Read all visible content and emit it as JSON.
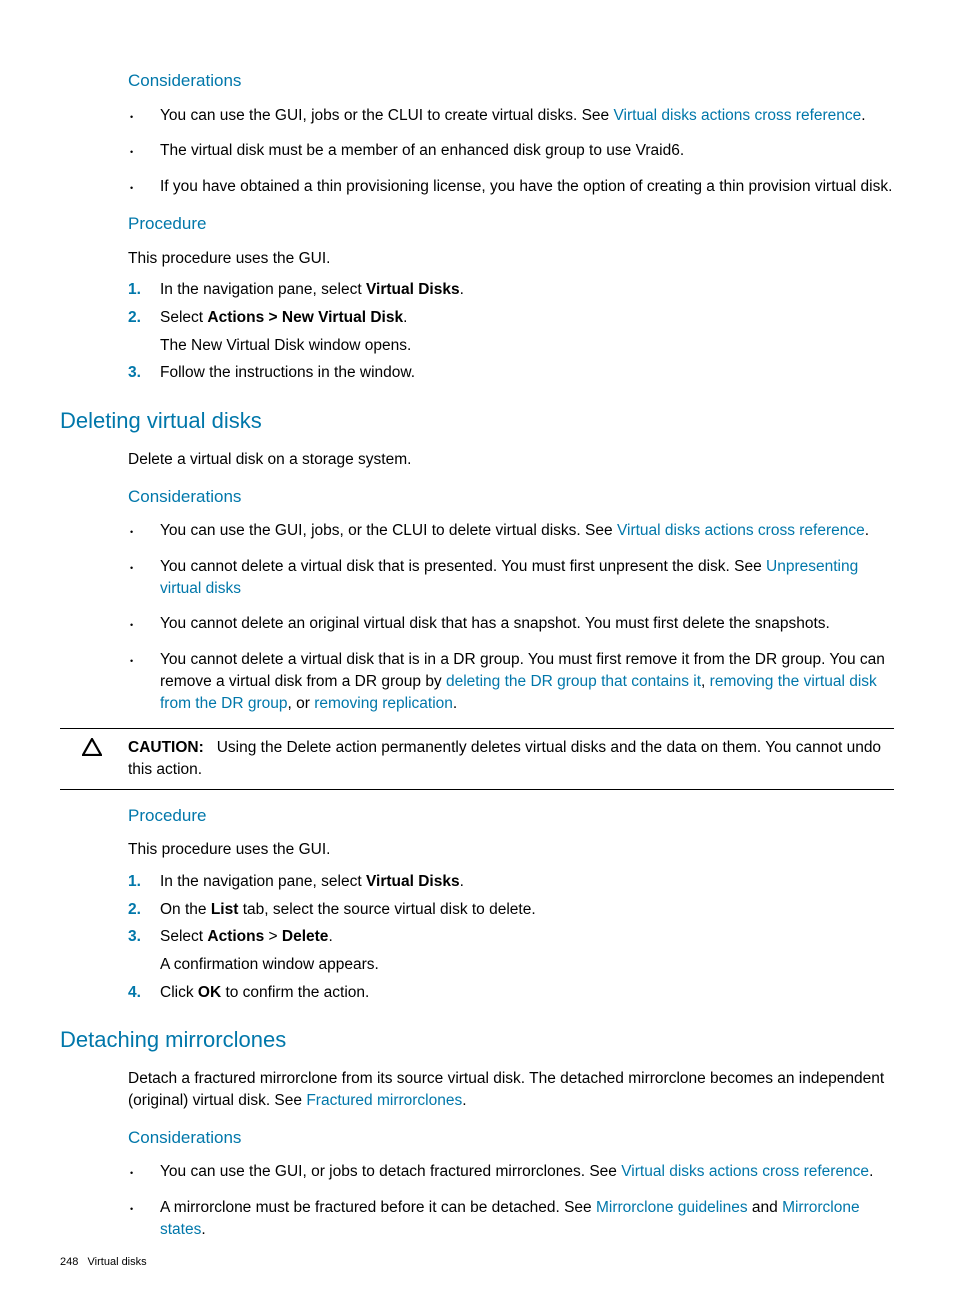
{
  "section1": {
    "considerations_h": "Considerations",
    "bullets": {
      "b1a": "You can use the GUI, jobs or the CLUI to create virtual disks. See ",
      "b1_link": "Virtual disks actions cross reference",
      "b2": "The virtual disk must be a member of an enhanced disk group to use Vraid6.",
      "b3": "If you have obtained a thin provisioning license, you have the option of creating a thin provision virtual disk."
    },
    "procedure_h": "Procedure",
    "procedure_intro": "This procedure uses the GUI.",
    "steps": {
      "s1a": "In the navigation pane, select ",
      "s1b": "Virtual Disks",
      "s1c": ".",
      "s2a": "Select ",
      "s2b": "Actions > New Virtual Disk",
      "s2c": ".",
      "s2_sub": "The New Virtual Disk window opens.",
      "s3": "Follow the instructions in the window."
    }
  },
  "section2": {
    "h": "Deleting virtual disks",
    "intro": "Delete a virtual disk on a storage system.",
    "considerations_h": "Considerations",
    "bullets": {
      "b1a": "You can use the GUI, jobs, or the CLUI to delete virtual disks. See ",
      "b1_link": "Virtual disks actions cross reference",
      "b2a": "You cannot delete a virtual disk that is presented. You must first unpresent the disk. See ",
      "b2_link": "Unpresenting virtual disks",
      "b3": "You cannot delete an original virtual disk that has a snapshot. You must first delete the snapshots.",
      "b4a": "You cannot delete a virtual disk that is in a DR group. You must first remove it from the DR group. You can remove a virtual disk from a DR group by ",
      "b4_link1": "deleting the DR group that contains it",
      "b4_sep1": ", ",
      "b4_link2": "removing the virtual disk from the DR group",
      "b4_sep2": ", or ",
      "b4_link3": "removing replication",
      "b4_end": "."
    },
    "caution_label": "CAUTION:",
    "caution_text": "Using the Delete action permanently deletes virtual disks and the data on them. You cannot undo this action.",
    "procedure_h": "Procedure",
    "procedure_intro": "This procedure uses the GUI.",
    "steps": {
      "s1a": "In the navigation pane, select ",
      "s1b": "Virtual Disks",
      "s1c": ".",
      "s2a": "On the ",
      "s2b": "List",
      "s2c": " tab, select the source virtual disk to delete.",
      "s3a": "Select ",
      "s3b": "Actions",
      "s3c": " > ",
      "s3d": "Delete",
      "s3e": ".",
      "s3_sub": "A confirmation window appears.",
      "s4a": "Click ",
      "s4b": "OK",
      "s4c": " to confirm the action."
    }
  },
  "section3": {
    "h": "Detaching mirrorclones",
    "intro_a": "Detach a fractured mirrorclone from its source virtual disk. The detached mirrorclone becomes an independent (original) virtual disk. See ",
    "intro_link": "Fractured mirrorclones",
    "intro_b": ".",
    "considerations_h": "Considerations",
    "bullets": {
      "b1a": "You can use the GUI, or jobs to detach fractured mirrorclones. See ",
      "b1_link": "Virtual disks actions cross reference",
      "b2a": "A mirrorclone must be fractured before it can be detached. See ",
      "b2_link1": "Mirrorclone guidelines",
      "b2_sep": " and ",
      "b2_link2": "Mirrorclone states",
      "b2_end": "."
    }
  },
  "footer": {
    "page_num": "248",
    "title": "Virtual disks"
  }
}
